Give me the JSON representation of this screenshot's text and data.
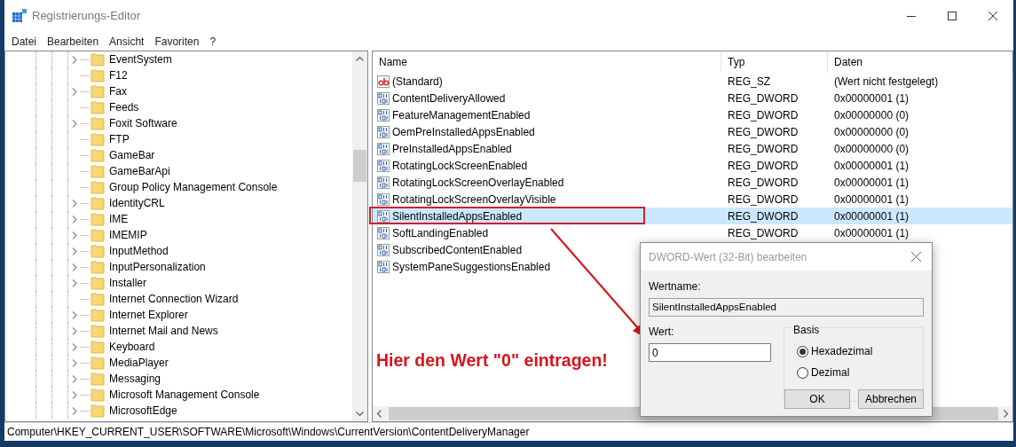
{
  "window": {
    "title": "Registrierungs-Editor"
  },
  "menu": [
    "Datei",
    "Bearbeiten",
    "Ansicht",
    "Favoriten",
    "?"
  ],
  "tree": {
    "items": [
      {
        "label": "EventSystem",
        "has_children": true
      },
      {
        "label": "F12",
        "has_children": false
      },
      {
        "label": "Fax",
        "has_children": true
      },
      {
        "label": "Feeds",
        "has_children": false
      },
      {
        "label": "Foxit Software",
        "has_children": true
      },
      {
        "label": "FTP",
        "has_children": false
      },
      {
        "label": "GameBar",
        "has_children": false
      },
      {
        "label": "GameBarApi",
        "has_children": false
      },
      {
        "label": "Group Policy Management Console",
        "has_children": false
      },
      {
        "label": "IdentityCRL",
        "has_children": true
      },
      {
        "label": "IME",
        "has_children": true
      },
      {
        "label": "IMEMIP",
        "has_children": true
      },
      {
        "label": "InputMethod",
        "has_children": true
      },
      {
        "label": "InputPersonalization",
        "has_children": true
      },
      {
        "label": "Installer",
        "has_children": true
      },
      {
        "label": "Internet Connection Wizard",
        "has_children": false
      },
      {
        "label": "Internet Explorer",
        "has_children": true
      },
      {
        "label": "Internet Mail and News",
        "has_children": true
      },
      {
        "label": "Keyboard",
        "has_children": true
      },
      {
        "label": "MediaPlayer",
        "has_children": true
      },
      {
        "label": "Messaging",
        "has_children": true
      },
      {
        "label": "Microsoft Management Console",
        "has_children": true
      },
      {
        "label": "MicrosoftEdge",
        "has_children": true
      }
    ]
  },
  "values": {
    "columns": [
      "Name",
      "Typ",
      "Daten"
    ],
    "rows": [
      {
        "kind": "string",
        "name": "(Standard)",
        "type": "REG_SZ",
        "data": "(Wert nicht festgelegt)",
        "selected": false
      },
      {
        "kind": "dword",
        "name": "ContentDeliveryAllowed",
        "type": "REG_DWORD",
        "data": "0x00000001 (1)",
        "selected": false
      },
      {
        "kind": "dword",
        "name": "FeatureManagementEnabled",
        "type": "REG_DWORD",
        "data": "0x00000000 (0)",
        "selected": false
      },
      {
        "kind": "dword",
        "name": "OemPreInstalledAppsEnabled",
        "type": "REG_DWORD",
        "data": "0x00000000 (0)",
        "selected": false
      },
      {
        "kind": "dword",
        "name": "PreInstalledAppsEnabled",
        "type": "REG_DWORD",
        "data": "0x00000000 (0)",
        "selected": false
      },
      {
        "kind": "dword",
        "name": "RotatingLockScreenEnabled",
        "type": "REG_DWORD",
        "data": "0x00000001 (1)",
        "selected": false
      },
      {
        "kind": "dword",
        "name": "RotatingLockScreenOverlayEnabled",
        "type": "REG_DWORD",
        "data": "0x00000001 (1)",
        "selected": false
      },
      {
        "kind": "dword",
        "name": "RotatingLockScreenOverlayVisible",
        "type": "REG_DWORD",
        "data": "0x00000001 (1)",
        "selected": false
      },
      {
        "kind": "dword",
        "name": "SilentInstalledAppsEnabled",
        "type": "REG_DWORD",
        "data": "0x00000001 (1)",
        "selected": true
      },
      {
        "kind": "dword",
        "name": "SoftLandingEnabled",
        "type": "REG_DWORD",
        "data": "0x00000001 (1)",
        "selected": false
      },
      {
        "kind": "dword",
        "name": "SubscribedContentEnabled",
        "selected": false
      },
      {
        "kind": "dword",
        "name": "SystemPaneSuggestionsEnabled",
        "selected": false
      }
    ]
  },
  "dialog": {
    "title": "DWORD-Wert (32-Bit) bearbeiten",
    "name_label": "Wertname:",
    "name_value": "SilentInstalledAppsEnabled",
    "value_label": "Wert:",
    "value": "0",
    "base_label": "Basis",
    "bases": [
      {
        "label": "Hexadezimal",
        "selected": true
      },
      {
        "label": "Dezimal",
        "selected": false
      }
    ],
    "buttons": [
      "OK",
      "Abbrechen"
    ]
  },
  "annotation": {
    "text": "Hier den Wert \"0\" eintragen!"
  },
  "status_bar": "Computer\\HKEY_CURRENT_USER\\SOFTWARE\\Microsoft\\Windows\\CurrentVersion\\ContentDeliveryManager"
}
